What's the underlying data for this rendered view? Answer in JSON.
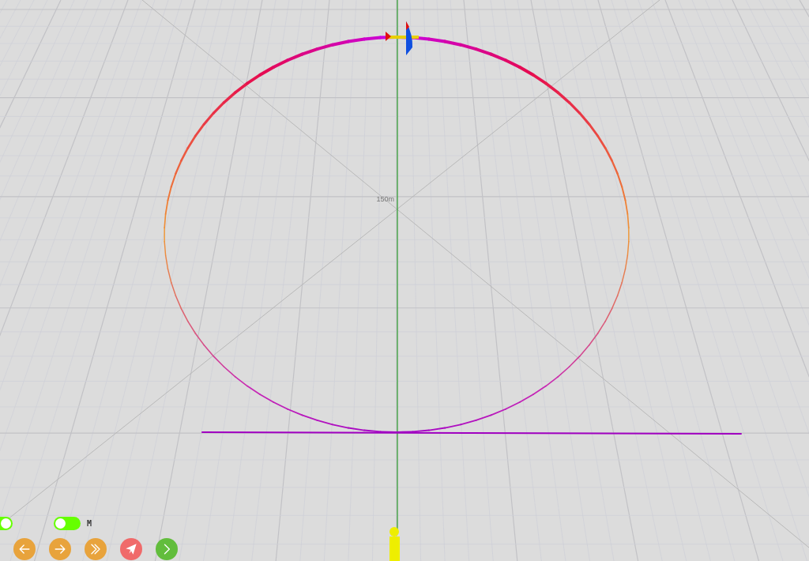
{
  "scene": {
    "distance_label": "150m"
  },
  "toggles": [
    {
      "on": true
    },
    {
      "on": false,
      "label": "M"
    }
  ],
  "buttons": [
    {
      "kind": "back"
    },
    {
      "kind": "forward"
    },
    {
      "kind": "fast-forward"
    },
    {
      "kind": "send"
    },
    {
      "kind": "next"
    }
  ]
}
